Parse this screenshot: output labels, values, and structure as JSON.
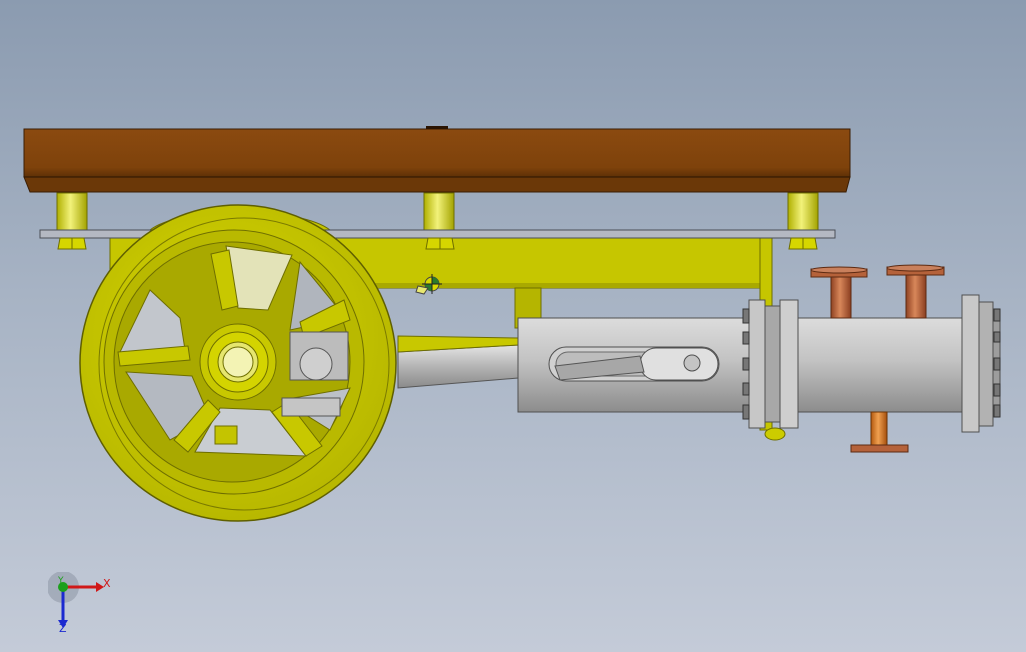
{
  "viewport": {
    "background_top": "#8b9bb0",
    "background_bottom": "#c4cbd8"
  },
  "model": {
    "colors": {
      "platform": "#86460d",
      "frame": "#c4c400",
      "frame_dark": "#8f8f00",
      "cylinder": "#b9b9b9",
      "copper": "#b5623a",
      "plate": "#b4b8c2"
    }
  },
  "triad": {
    "x_label": "X",
    "y_label": "Y",
    "z_label": "Z",
    "x_color": "#d01818",
    "y_color": "#1ca01c",
    "z_color": "#1c2ad0"
  },
  "icons": {
    "origin": "origin-marker-icon"
  }
}
